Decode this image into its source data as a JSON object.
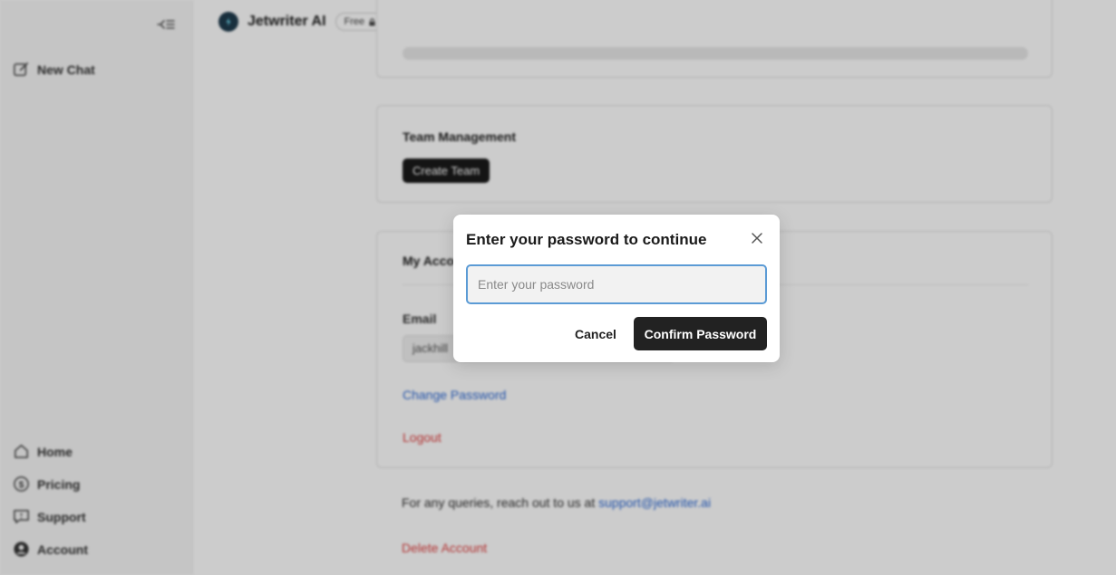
{
  "sidebar": {
    "new_chat": "New Chat",
    "nav": {
      "home": "Home",
      "pricing": "Pricing",
      "support": "Support",
      "account": "Account"
    }
  },
  "header": {
    "brand": "Jetwriter AI",
    "plan": "Free"
  },
  "team": {
    "title": "Team Management",
    "create_button": "Create Team"
  },
  "account": {
    "title": "My Account",
    "email_label": "Email",
    "email_value": "jackhill",
    "change_password": "Change Password",
    "logout": "Logout"
  },
  "footer": {
    "text": "For any queries, reach out to us at ",
    "email": "support@jetwriter.ai",
    "delete": "Delete Account"
  },
  "modal": {
    "title": "Enter your password to continue",
    "placeholder": "Enter your password",
    "cancel": "Cancel",
    "confirm": "Confirm Password"
  },
  "colors": {
    "accent_dark": "#222222",
    "link_blue": "#2f6bd6",
    "danger_red": "#e04040",
    "input_focus": "#5b9bd5"
  }
}
